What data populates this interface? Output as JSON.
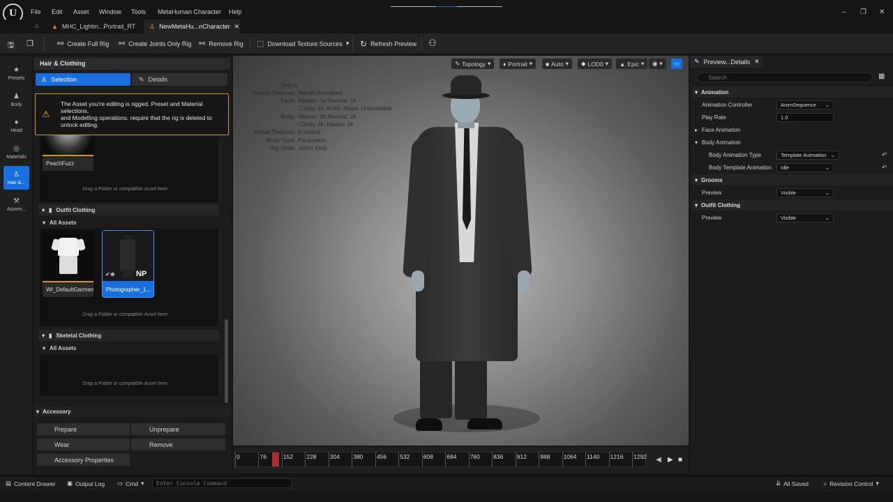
{
  "menu": {
    "logo": "U",
    "items": [
      "File",
      "Edit",
      "Asset",
      "Window",
      "Tools",
      "MetaHuman Character",
      "Help"
    ],
    "window_controls": [
      "–",
      "❐",
      "✕"
    ]
  },
  "tabs": [
    {
      "label": "MHC_Lightin...Portrait_RT"
    },
    {
      "label": "NewMetaHu...nCharacter",
      "close": "✕"
    }
  ],
  "toolbar": {
    "create_full_rig": "Create Full Rig",
    "create_joints_rig": "Create Joints Only Rig",
    "remove_rig": "Remove Rig",
    "download_textures": "Download Texture Sources",
    "refresh_preview": "Refresh Preview"
  },
  "sidebar": [
    {
      "label": "Presets",
      "icon": "★"
    },
    {
      "label": "Body",
      "icon": "♟"
    },
    {
      "label": "Head",
      "icon": "●"
    },
    {
      "label": "Materials",
      "icon": "◎"
    },
    {
      "label": "Hair &...",
      "icon": "♙"
    },
    {
      "label": "Assem...",
      "icon": "⚒"
    }
  ],
  "left_panel": {
    "title": "Hair & Clothing",
    "tab_selection": "Selection",
    "tab_details": "Details",
    "warning": "The Asset you're editing is rigged. Preset and Material selections,\nand Modelling operations, require that the rig is deleted to unlock editing.",
    "peachfuzz_label": "PeachFuzz",
    "drag_hint": "Drag a Folder or compatible Asset here.",
    "outfit_clothing": "Outfit Clothing",
    "all_assets": "All Assets",
    "tile_default": "WI_DefaultGarment",
    "tile_photographer": "Photographer_1...",
    "np_badge": "NP",
    "skeletal_clothing": "Skeletal Clothing",
    "accessory": "Accessory",
    "prepare": "Prepare",
    "unprepare": "Unprepare",
    "wear": "Wear",
    "remove": "Remove",
    "accessory_properties": "Accessory Properties"
  },
  "viewport": {
    "buttons": [
      "Topology",
      "Portrait",
      "Auto",
      "LOD0",
      "Epic"
    ],
    "status_title": "Status",
    "status": [
      {
        "k": "Texture Sources:",
        "v": "Needs download"
      },
      {
        "k": "Face:",
        "v": "Albedo: 1k Normal: 1k"
      },
      {
        "k": "",
        "v": ": Cavity 1k: Anim. Maps: Unavailable"
      },
      {
        "k": "Body:",
        "v": "Albedo: 2k Normal: 2k"
      },
      {
        "k": "",
        "v": ": Cavity 2k, Masks: 1k"
      },
      {
        "k": "Virtual Textures:",
        "v": "Enabled"
      },
      {
        "k": "Body Type:",
        "v": "Parametric"
      },
      {
        "k": "Rig State:",
        "v": "Joints Only"
      }
    ]
  },
  "timeline": {
    "ticks": [
      "0",
      "76",
      "152",
      "228",
      "304",
      "380",
      "456",
      "532",
      "608",
      "684",
      "760",
      "836",
      "912",
      "988",
      "1064",
      "1140",
      "1216",
      "1292"
    ]
  },
  "details": {
    "tab_label": "Preview...Details",
    "search_placeholder": "Search",
    "animation": "Animation",
    "animation_controller": "Animation Controller",
    "anim_sequence": "AnimSequence",
    "play_rate": "Play Rate",
    "play_rate_value": "1.0",
    "face_animation": "Face Animation",
    "body_animation": "Body Animation",
    "body_animation_type": "Body Animation Type",
    "template_animation": "Template Animation",
    "body_template_animation": "Body Template Animation",
    "idle": "Idle",
    "grooms": "Grooms",
    "preview": "Preview",
    "visible": "Visible",
    "outfit_clothing": "Outfit Clothing"
  },
  "statusbar": {
    "content_drawer": "Content Drawer",
    "output_log": "Output Log",
    "cmd": "Cmd",
    "console_placeholder": "Enter Console Command",
    "all_saved": "All Saved",
    "revision_control": "Revision Control"
  },
  "colors": {
    "accent": "#1a6fe0",
    "warning": "#c8962a",
    "timeline_marker": "#a83232"
  }
}
